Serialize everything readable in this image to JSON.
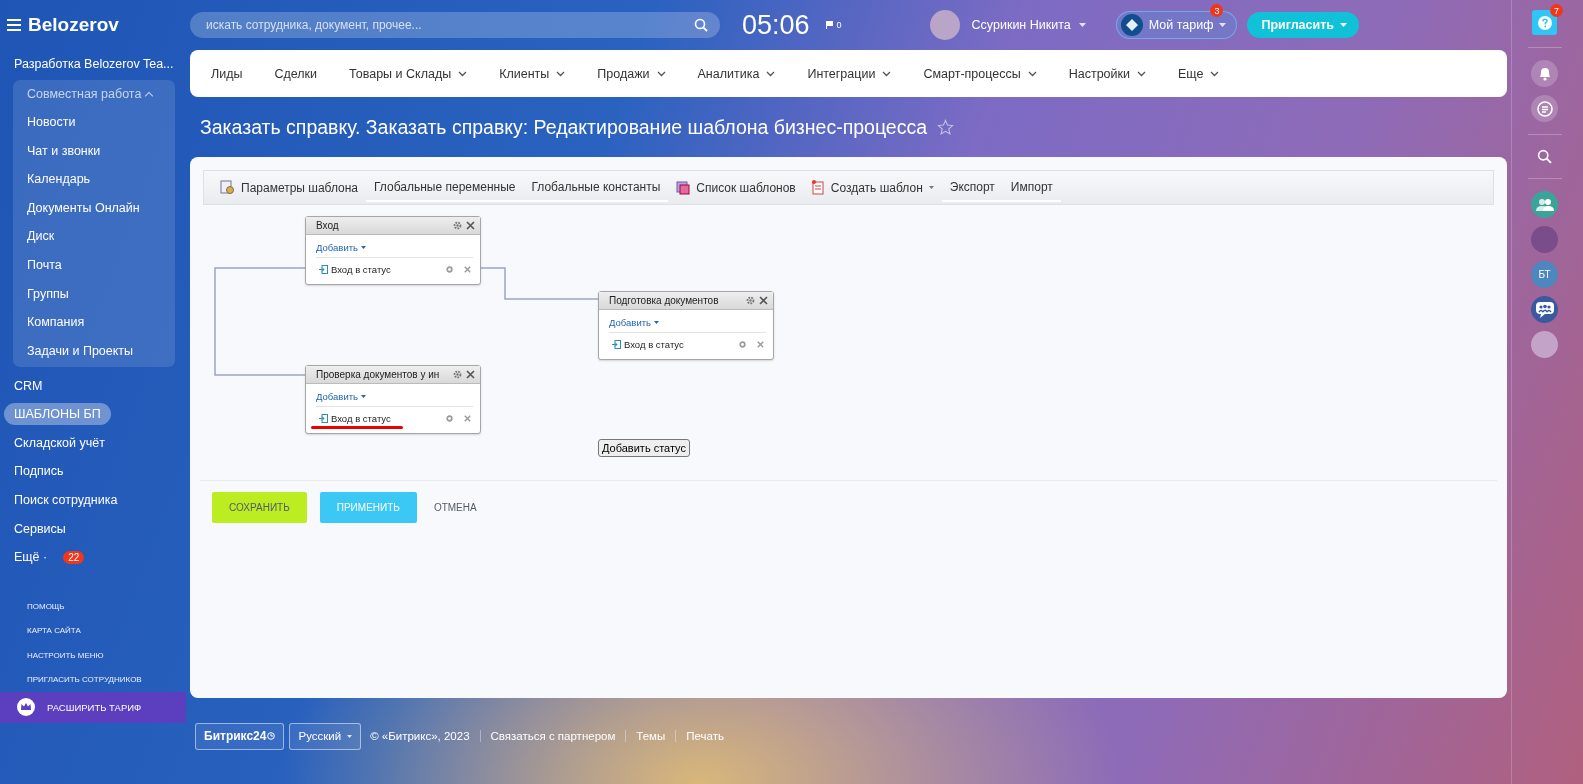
{
  "header": {
    "logo": "Belozerov",
    "search": {
      "placeholder": "искать сотрудника, документ, прочее..."
    },
    "clock": "05:06",
    "flag_count": "0",
    "user_name": "Ссурикин Никита",
    "tariff": {
      "label": "Мой тариф",
      "badge": "3"
    },
    "invite": "Пригласить"
  },
  "sidebar": {
    "project": "Разработка Belozerov Tea...",
    "group": {
      "label": "Совместная работа",
      "expanded": true,
      "items": [
        {
          "label": "Новости",
          "selected": false
        },
        {
          "label": "Чат и звонки",
          "selected": false
        },
        {
          "label": "Календарь",
          "selected": false
        },
        {
          "label": "Документы Онлайн",
          "selected": false
        },
        {
          "label": "Диск",
          "selected": false
        },
        {
          "label": "Почта",
          "selected": false
        },
        {
          "label": "Группы",
          "selected": false
        },
        {
          "label": "Компания",
          "selected": false
        },
        {
          "label": "Задачи и Проекты",
          "selected": false
        }
      ]
    },
    "items": [
      {
        "label": "CRM",
        "selected": false
      },
      {
        "label": "ШАБЛОНЫ БП",
        "selected": true
      },
      {
        "label": "Складской учёт",
        "selected": false
      },
      {
        "label": "Подпись",
        "selected": false
      },
      {
        "label": "Поиск сотрудника",
        "selected": false
      },
      {
        "label": "Сервисы",
        "selected": false
      }
    ],
    "more": {
      "label": "Ещё ·",
      "badge": "22"
    },
    "links": [
      "ПОМОЩЬ",
      "КАРТА САЙТА",
      "НАСТРОИТЬ МЕНЮ",
      "ПРИГЛАСИТЬ СОТРУДНИКОВ"
    ],
    "upgrade": "РАСШИРИТЬ ТАРИФ"
  },
  "right_bar": {
    "help_badge": "7",
    "contact_initials": "БТ"
  },
  "top_nav": [
    {
      "label": "Лиды",
      "dropdown": false
    },
    {
      "label": "Сделки",
      "dropdown": false
    },
    {
      "label": "Товары и Склады",
      "dropdown": true
    },
    {
      "label": "Клиенты",
      "dropdown": true
    },
    {
      "label": "Продажи",
      "dropdown": true
    },
    {
      "label": "Аналитика",
      "dropdown": true
    },
    {
      "label": "Интеграции",
      "dropdown": true
    },
    {
      "label": "Смарт-процессы",
      "dropdown": true
    },
    {
      "label": "Настройки",
      "dropdown": true
    },
    {
      "label": "Еще",
      "dropdown": true
    }
  ],
  "page_title": "Заказать справку. Заказать справку: Редактирование шаблона бизнес-процесса",
  "toolbar": [
    {
      "label": "Параметры шаблона",
      "kind": "params",
      "dropdown": false
    },
    {
      "label": "Глобальные переменные",
      "kind": "plain",
      "dropdown": false
    },
    {
      "label": "Глобальные константы",
      "kind": "plain",
      "dropdown": false
    },
    {
      "label": "Список шаблонов",
      "kind": "list",
      "dropdown": false
    },
    {
      "label": "Создать шаблон",
      "kind": "create",
      "dropdown": true
    },
    {
      "label": "Экспорт",
      "kind": "plain",
      "dropdown": false
    },
    {
      "label": "Импорт",
      "kind": "plain",
      "dropdown": false
    }
  ],
  "diagram": {
    "states": [
      {
        "title": "Вход",
        "add_label": "Добавить",
        "items": [
          {
            "label": "Вход в статус",
            "underlined": false
          }
        ]
      },
      {
        "title": "Подготовка документов",
        "add_label": "Добавить",
        "items": [
          {
            "label": "Вход в статус",
            "underlined": false
          }
        ]
      },
      {
        "title": "Проверка документов у ин",
        "add_label": "Добавить",
        "items": [
          {
            "label": "Вход в статус",
            "underlined": true
          }
        ]
      }
    ],
    "add_status": "Добавить статус"
  },
  "buttons": [
    {
      "label": "СОХРАНИТЬ",
      "kind": "save"
    },
    {
      "label": "ПРИМЕНИТЬ",
      "kind": "apply"
    },
    {
      "label": "ОТМЕНА",
      "kind": "cancel"
    }
  ],
  "footer": {
    "logo": "Битрикс24",
    "language": "Русский",
    "copyright": "© «Битрикс», 2023",
    "links": [
      "Связаться с партнером",
      "Темы",
      "Печать"
    ]
  }
}
